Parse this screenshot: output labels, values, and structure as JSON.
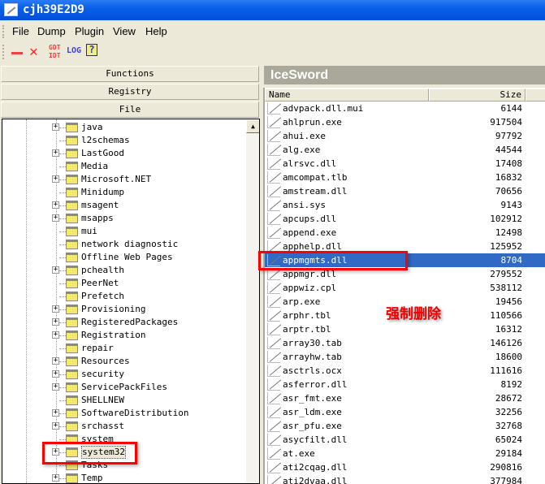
{
  "window": {
    "title": "cjh39E2D9"
  },
  "menu": [
    "File",
    "Dump",
    "Plugin",
    "View",
    "Help"
  ],
  "toolbar": {
    "gdt_idt_top": "GDT",
    "gdt_idt_bottom": "IDT",
    "log": "LOG",
    "help": "?"
  },
  "sidebar": {
    "functions": "Functions",
    "registry": "Registry",
    "file": "File"
  },
  "tree": [
    {
      "label": "java",
      "expandable": true
    },
    {
      "label": "l2schemas",
      "expandable": false
    },
    {
      "label": "LastGood",
      "expandable": true
    },
    {
      "label": "Media",
      "expandable": false
    },
    {
      "label": "Microsoft.NET",
      "expandable": true
    },
    {
      "label": "Minidump",
      "expandable": false
    },
    {
      "label": "msagent",
      "expandable": true
    },
    {
      "label": "msapps",
      "expandable": true
    },
    {
      "label": "mui",
      "expandable": false
    },
    {
      "label": "network diagnostic",
      "expandable": false
    },
    {
      "label": "Offline Web Pages",
      "expandable": false
    },
    {
      "label": "pchealth",
      "expandable": true
    },
    {
      "label": "PeerNet",
      "expandable": false
    },
    {
      "label": "Prefetch",
      "expandable": false
    },
    {
      "label": "Provisioning",
      "expandable": true
    },
    {
      "label": "RegisteredPackages",
      "expandable": true
    },
    {
      "label": "Registration",
      "expandable": true
    },
    {
      "label": "repair",
      "expandable": false
    },
    {
      "label": "Resources",
      "expandable": true
    },
    {
      "label": "security",
      "expandable": true
    },
    {
      "label": "ServicePackFiles",
      "expandable": true
    },
    {
      "label": "SHELLNEW",
      "expandable": false
    },
    {
      "label": "SoftwareDistribution",
      "expandable": true
    },
    {
      "label": "srchasst",
      "expandable": true
    },
    {
      "label": "system",
      "expandable": false
    },
    {
      "label": "system32",
      "expandable": true,
      "selected": true
    },
    {
      "label": "Tasks",
      "expandable": false
    },
    {
      "label": "Temp",
      "expandable": true
    }
  ],
  "panel": {
    "title": "IceSword",
    "col_name": "Name",
    "col_size": "Size"
  },
  "files": [
    [
      "advpack.dll.mui",
      "6144"
    ],
    [
      "ahlprun.exe",
      "917504"
    ],
    [
      "ahui.exe",
      "97792"
    ],
    [
      "alg.exe",
      "44544"
    ],
    [
      "alrsvc.dll",
      "17408"
    ],
    [
      "amcompat.tlb",
      "16832"
    ],
    [
      "amstream.dll",
      "70656"
    ],
    [
      "ansi.sys",
      "9143"
    ],
    [
      "apcups.dll",
      "102912"
    ],
    [
      "append.exe",
      "12498"
    ],
    [
      "apphelp.dll",
      "125952"
    ],
    [
      "appmgmts.dll",
      "8704"
    ],
    [
      "appmgr.dll",
      "279552"
    ],
    [
      "appwiz.cpl",
      "538112"
    ],
    [
      "arp.exe",
      "19456"
    ],
    [
      "arphr.tbl",
      "110566"
    ],
    [
      "arptr.tbl",
      "16312"
    ],
    [
      "array30.tab",
      "146126"
    ],
    [
      "arrayhw.tab",
      "18600"
    ],
    [
      "asctrls.ocx",
      "111616"
    ],
    [
      "asferror.dll",
      "8192"
    ],
    [
      "asr_fmt.exe",
      "28672"
    ],
    [
      "asr_ldm.exe",
      "32256"
    ],
    [
      "asr_pfu.exe",
      "32768"
    ],
    [
      "asycfilt.dll",
      "65024"
    ],
    [
      "at.exe",
      "29184"
    ],
    [
      "ati2cqag.dll",
      "290816"
    ],
    [
      "ati2dvaa.dll",
      "377984"
    ]
  ],
  "selected_file": "appmgmts.dll",
  "annotation": "强制删除",
  "colors": {
    "accent": "#316ac5",
    "annotation": "#ff0000"
  }
}
